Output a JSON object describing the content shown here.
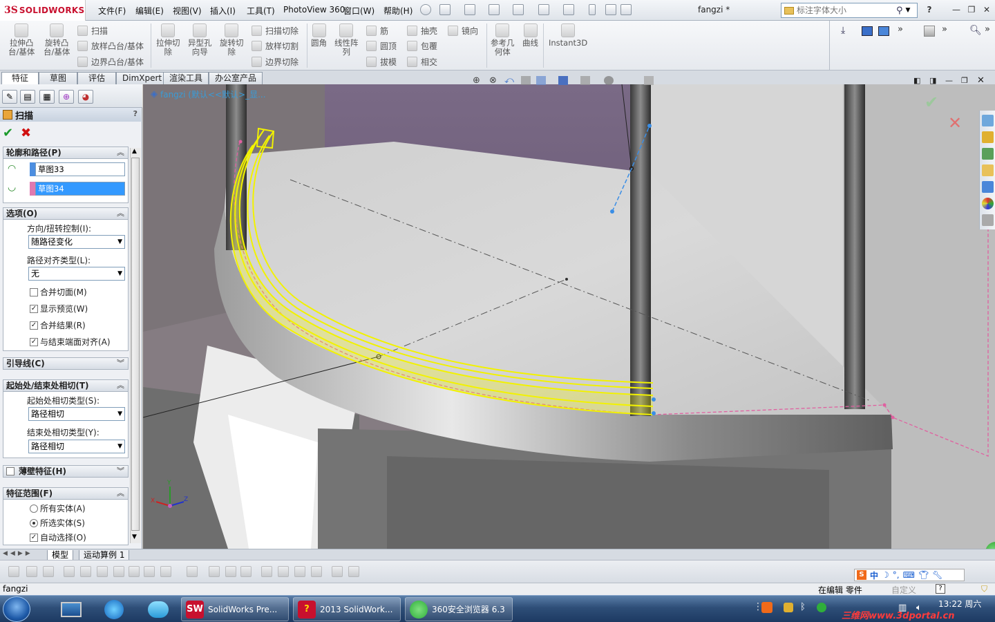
{
  "app": {
    "logo_mark": "3S",
    "logo_text": "SOLIDWORKS",
    "document_title": "fangzi *",
    "search_placeholder": "标注字体大小",
    "help_label": "?"
  },
  "menu": [
    "文件(F)",
    "编辑(E)",
    "视图(V)",
    "插入(I)",
    "工具(T)",
    "PhotoView 360",
    "窗口(W)",
    "帮助(H)"
  ],
  "command_manager": {
    "big_buttons": [
      {
        "label": "拉伸凸\n台/基体"
      },
      {
        "label": "旋转凸\n台/基体"
      },
      {
        "label": "拉伸切\n除"
      },
      {
        "label": "异型孔\n向导"
      },
      {
        "label": "旋转切\n除"
      },
      {
        "label": "圆角"
      },
      {
        "label": "线性阵\n列"
      },
      {
        "label": "参考几\n何体"
      },
      {
        "label": "曲线"
      },
      {
        "label": "Instant3D"
      }
    ],
    "small_col1": [
      "扫描",
      "放样凸台/基体",
      "边界凸台/基体"
    ],
    "small_col2": [
      "扫描切除",
      "放样切割",
      "边界切除"
    ],
    "small_col3": [
      "筋",
      "圆顶",
      "拔模"
    ],
    "small_col4": [
      "抽壳",
      "包覆",
      "相交"
    ],
    "small_col5": [
      "镜向"
    ]
  },
  "tabs": [
    "特征",
    "草图",
    "评估",
    "DimXpert",
    "渲染工具",
    "办公室产品"
  ],
  "active_tab": "特征",
  "feature_tree_flyout": "fangzi  (默认<<默认>_显...",
  "property_manager": {
    "title": "扫描",
    "help": "?",
    "sections": {
      "profile_path": {
        "header": "轮廓和路径(P)",
        "profile": "草图33",
        "path": "草图34"
      },
      "options": {
        "header": "选项(O)",
        "orientation_label": "方向/扭转控制(I):",
        "orientation_value": "随路径变化",
        "path_align_label": "路径对齐类型(L):",
        "path_align_value": "无",
        "checkboxes": [
          {
            "label": "合并切面(M)",
            "checked": false
          },
          {
            "label": "显示预览(W)",
            "checked": true
          },
          {
            "label": "合并结果(R)",
            "checked": true
          },
          {
            "label": "与结束端面对齐(A)",
            "checked": true
          }
        ]
      },
      "guide_curves": {
        "header": "引导线(C)"
      },
      "tangency": {
        "header": "起始处/结束处相切(T)",
        "start_label": "起始处相切类型(S):",
        "start_value": "路径相切",
        "end_label": "结束处相切类型(Y):",
        "end_value": "路径相切"
      },
      "thin_feature": {
        "header": "薄壁特征(H)",
        "checked": false
      },
      "feature_scope": {
        "header": "特征范围(F)",
        "options": [
          {
            "label": "所有实体(A)",
            "selected": false
          },
          {
            "label": "所选实体(S)",
            "selected": true
          }
        ],
        "auto_select": {
          "label": "自动选择(O)",
          "checked": true
        }
      }
    }
  },
  "bottom_tabs": [
    "模型",
    "运动算例 1"
  ],
  "status_bar": {
    "left": "fangzi",
    "mode": "在编辑 零件",
    "units": "自定义"
  },
  "taskbar": {
    "apps": [
      {
        "label": "SolidWorks Pre...",
        "color": "#c8102e"
      },
      {
        "label": "2013 SolidWork...",
        "color": "#c8102e"
      },
      {
        "label": "360安全浏览器 6.3",
        "color": "#2fae3b"
      }
    ],
    "ime": "中",
    "clock": "13:22 周六",
    "watermark": "三维网www.3dportal.cn"
  },
  "triad": {
    "x": "X",
    "y": "Y",
    "z": "Z"
  },
  "colors": {
    "accent": "#3399ff",
    "preview_yellow": "#f2f200",
    "path_pink": "#e060a0",
    "ok_green": "#1a9a2a",
    "cancel_red": "#d01010"
  }
}
